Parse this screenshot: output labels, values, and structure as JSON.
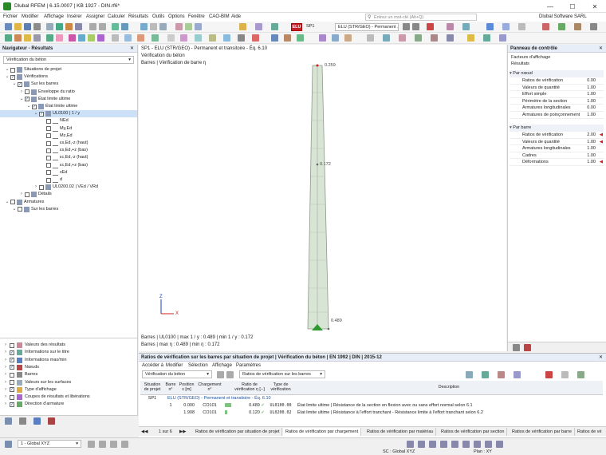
{
  "window": {
    "title": "Dlubal RFEM | 6.15.0007 | KB 1927 - DIN.rf6*"
  },
  "menu": [
    "Fichier",
    "Modifier",
    "Affichage",
    "Insérer",
    "Assigner",
    "Calculer",
    "Résultats",
    "Outils",
    "Options",
    "Fenêtre",
    "CAO-BIM",
    "Aide"
  ],
  "search": {
    "placeholder": "Entrez un mot-clé (Alt+Q)"
  },
  "company": "Dlubal Software SARL",
  "toolbar": {
    "lc_badge": "ELU",
    "lc_code": "SP1",
    "lc_name": "ELU (STR/GEO) - Permanent ..."
  },
  "navigator": {
    "title": "Navigateur - Résultats",
    "dropdown": "Vérification du béton",
    "tree": [
      {
        "label": "Situations de projet",
        "level": 0,
        "checked": false
      },
      {
        "label": "Vérifications",
        "level": 0,
        "checked": true
      },
      {
        "label": "Sur les barres",
        "level": 1,
        "checked": true
      },
      {
        "label": "Enveloppe du ratio",
        "level": 2,
        "checked": false
      },
      {
        "label": "État limite ultime",
        "level": 2,
        "checked": true
      },
      {
        "label": "État limite ultime",
        "level": 3,
        "checked": true
      },
      {
        "label": "UL0100 | 1 / y",
        "level": 4,
        "checked": true,
        "selected": true
      },
      {
        "label": "NEd",
        "level": 5,
        "checked": false
      },
      {
        "label": "My,Ed",
        "level": 5,
        "checked": false
      },
      {
        "label": "Mz,Ed",
        "level": 5,
        "checked": false
      },
      {
        "label": "εs,Ed,-z (haut)",
        "level": 5,
        "checked": false
      },
      {
        "label": "εs,Ed,+z (bas)",
        "level": 5,
        "checked": false
      },
      {
        "label": "εc,Ed,-z (haut)",
        "level": 5,
        "checked": false
      },
      {
        "label": "εc,Ed,+z (bas)",
        "level": 5,
        "checked": false
      },
      {
        "label": "xEd",
        "level": 5,
        "checked": false
      },
      {
        "label": "d",
        "level": 5,
        "checked": false
      },
      {
        "label": "UL0200.02 | VEd / VRd",
        "level": 4,
        "checked": false
      },
      {
        "label": "Détails",
        "level": 2,
        "checked": false
      },
      {
        "label": "Armatures",
        "level": 0,
        "checked": false
      },
      {
        "label": "Sur les barres",
        "level": 1,
        "checked": false
      }
    ],
    "lower": [
      {
        "label": "Valeurs des résultats",
        "checked": false
      },
      {
        "label": "Informations sur le titre",
        "checked": true
      },
      {
        "label": "Informations max/min",
        "checked": true
      },
      {
        "label": "Nœuds",
        "checked": true
      },
      {
        "label": "Barres",
        "checked": false
      },
      {
        "label": "Valeurs sur les surfaces",
        "checked": false
      },
      {
        "label": "Type d'affichage",
        "checked": true
      },
      {
        "label": "Coupes de résultats et libérations",
        "checked": false
      },
      {
        "label": "Direction d'armature",
        "checked": true
      }
    ]
  },
  "view": {
    "header1": "SP1 - ELU (STR/GEO) - Permanent et transitoire - Éq. 6.10",
    "header2": "Vérification du béton",
    "header3": "Barres | Vérification de barre η",
    "label_top": "0.259",
    "label_mid": "0.172",
    "label_bot": "0.489",
    "axis_z": "Z",
    "axis_x": "X",
    "footer1": "Barres | UL0100 | max 1 / y : 0.489 | min 1 / y : 0.172",
    "footer2": "Barres | max η : 0.489 | min η : 0.172"
  },
  "control": {
    "title": "Panneau de contrôle",
    "subtitle1": "Facteurs d'affichage",
    "subtitle2": "Résultats",
    "group1": "Par nœud",
    "group1_rows": [
      {
        "label": "Ratios de vérification",
        "value": "0.00"
      },
      {
        "label": "Valeurs de quantité",
        "value": "1.00"
      },
      {
        "label": "Effort simple",
        "value": "1.00"
      },
      {
        "label": "Périmètre de la section",
        "value": "1.00"
      },
      {
        "label": "Armatures longitudinales",
        "value": "0.00"
      },
      {
        "label": "Armatures de poinçonnement",
        "value": "1.00"
      }
    ],
    "group2": "Par barre",
    "group2_rows": [
      {
        "label": "Ratios de vérification",
        "value": "2.00",
        "flag": true
      },
      {
        "label": "Valeurs de quantité",
        "value": "1.00",
        "flag": true
      },
      {
        "label": "Armatures longitudinales",
        "value": "1.00",
        "flag": false
      },
      {
        "label": "Cadres",
        "value": "1.00",
        "flag": false
      },
      {
        "label": "Déformations",
        "value": "1.00",
        "flag": true
      }
    ]
  },
  "results": {
    "title": "Ratios de vérification sur les barres par situation de projet | Vérification du béton | EN 1992 | DIN | 2015-12",
    "menu": [
      "Accéder à",
      "Modifier",
      "Sélection",
      "Affichage",
      "Paramètres"
    ],
    "dd1": "Vérification du béton",
    "dd2": "Ratios de vérification sur les barres",
    "headers": [
      "Situation\nde projet",
      "Barre\nn°",
      "Position\nx [m]",
      "Chargement\nn°",
      "",
      "Ratio de\nvérification η [--]",
      "Type de\nvérification",
      "Description"
    ],
    "situation_row": {
      "sp": "SP1",
      "text": "ELU (STR/GEO) - Permanent et transitoire - Éq. 6.10"
    },
    "rows": [
      {
        "bar": "1",
        "x": "0.000",
        "load": "CO101",
        "ratio": "0.489",
        "type": "UL0100.00",
        "desc": "État limite ultime | Résistance de la section en flexion avec ou sans effort normal selon 6.1"
      },
      {
        "bar": "",
        "x": "1.908",
        "load": "CO101",
        "ratio": "0.120",
        "type": "UL0200.02",
        "desc": "État limite ultime | Résistance à l'effort tranchant - Résistance limite à l'effort tranchant selon 6.2"
      }
    ],
    "pager": "1 sur 6",
    "tabs": [
      "Ratios de vérification par situation de projet",
      "Ratios de vérification par chargement",
      "Ratios de vérification par matériau",
      "Ratios de vérification par section",
      "Ratios de vérification par barre",
      "Ratios de vé"
    ]
  },
  "status": {
    "coord_system": "1 - Global XYZ",
    "sc": "SC : Global XYZ",
    "plane": "Plan : XY"
  },
  "colors": {
    "accent": "#1a4fa0",
    "member_fill": "#d8e4d4",
    "member_stroke": "#8a9a88",
    "flag": "#d02020"
  }
}
